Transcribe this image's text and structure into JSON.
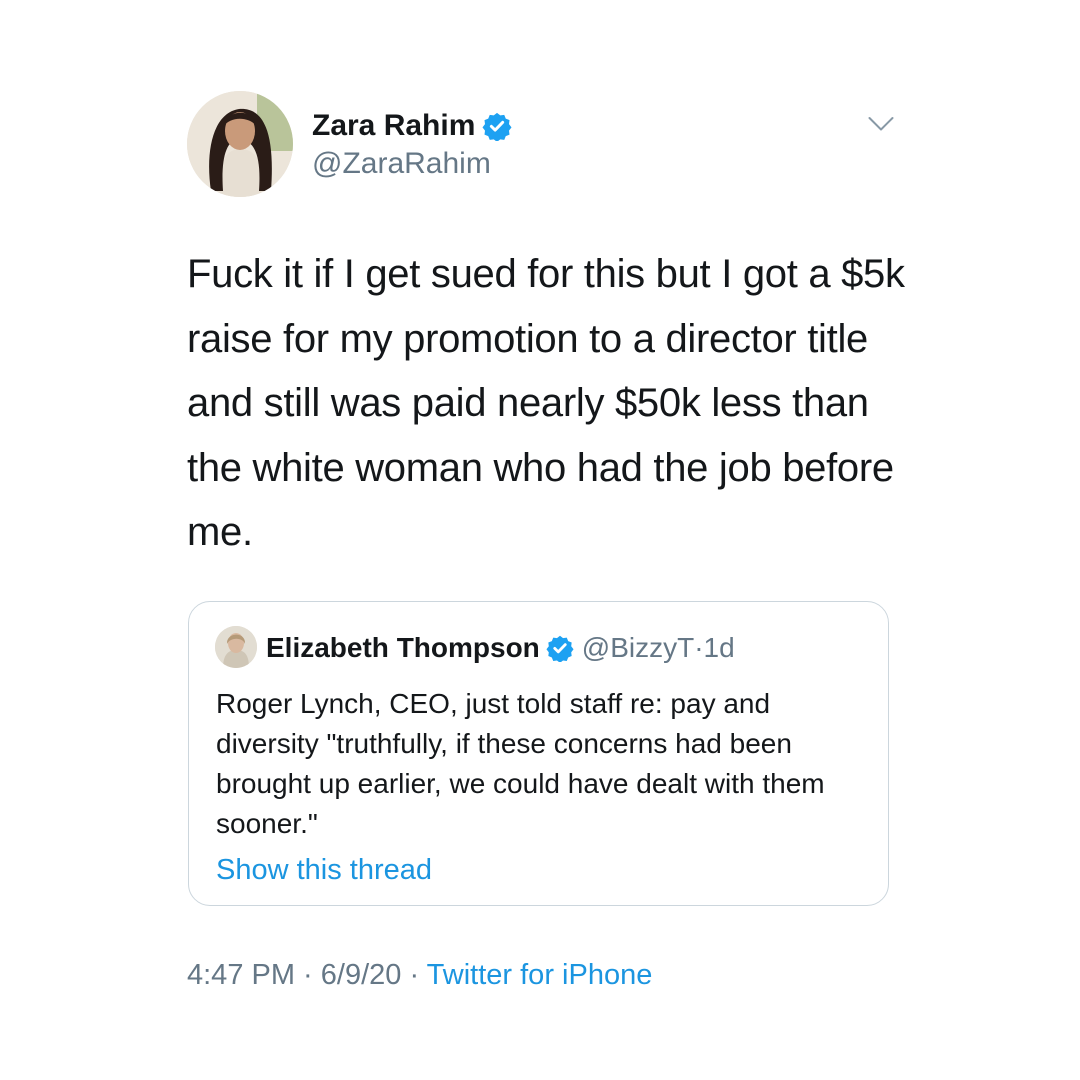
{
  "author": {
    "display_name": "Zara Rahim",
    "handle": "@ZaraRahim",
    "avatar_icon": "profile-photo",
    "verified_icon": "verified-badge-icon"
  },
  "menu": {
    "caret_icon": "chevron-down-icon"
  },
  "tweet": {
    "text": "Fuck it if I get sued for this but I got a $5k raise for my promotion to a director title and still was paid nearly $50k less than the white woman who had the job before me."
  },
  "quoted_tweet": {
    "display_name": "Elizabeth Thompson",
    "handle": "@BizzyT",
    "separator": " · ",
    "age": "1d",
    "text": "Roger Lynch, CEO, just told staff re: pay and diversity \"truthfully, if these concerns had been brought up earlier, we could have dealt with them sooner.\"",
    "show_thread": "Show this thread"
  },
  "meta": {
    "time": "4:47 PM",
    "sep1": " · ",
    "date": "6/9/20",
    "sep2": " · ",
    "source": "Twitter for iPhone"
  },
  "colors": {
    "link": "#1b95e0",
    "secondary_text": "#657786",
    "verified": "#1da1f2",
    "border": "#ccd6dd"
  }
}
